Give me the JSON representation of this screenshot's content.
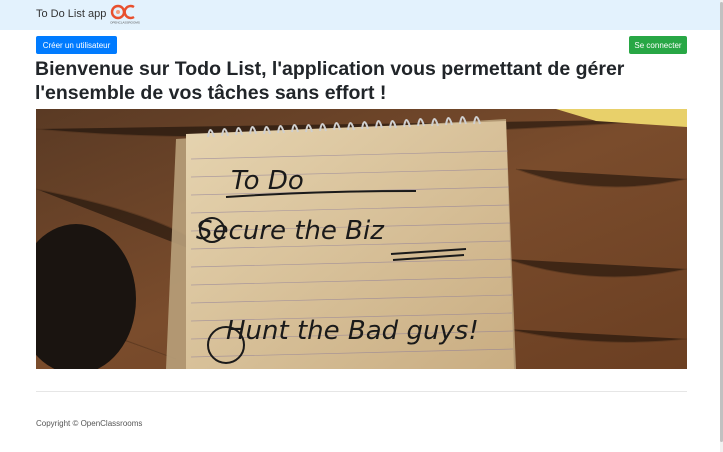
{
  "navbar": {
    "brand": "To Do List app",
    "logo_text": "OC",
    "logo_subtext": "OPENCLASSROOMS"
  },
  "actions": {
    "create_user": "Créer un utilisateur",
    "login": "Se connecter"
  },
  "main": {
    "welcome_line1": "Bienvenue sur Todo List, l'application vous permettant de gérer",
    "welcome_line2": "l'ensemble de vos tâches sans effort !",
    "hero_image": {
      "title": "To Do",
      "item1": "Secure the Biz",
      "item2": "Hunt the Bad guys!"
    }
  },
  "footer": {
    "copyright": "Copyright © OpenClassrooms"
  },
  "colors": {
    "navbar_bg": "#e3f2fd",
    "primary": "#007bff",
    "success": "#28a745"
  }
}
